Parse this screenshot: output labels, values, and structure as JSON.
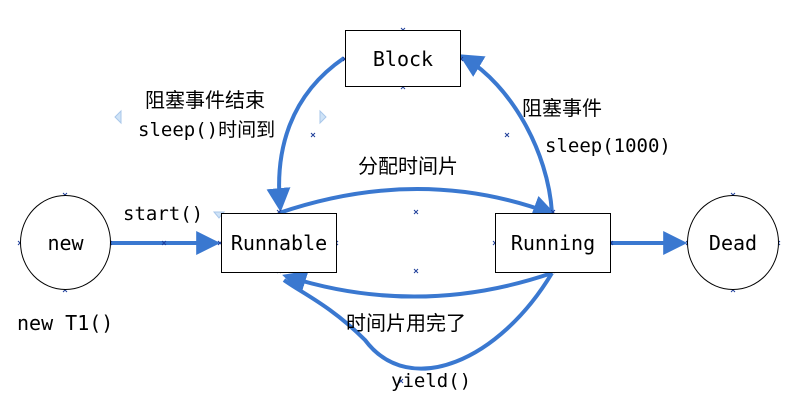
{
  "nodes": {
    "new": "new",
    "runnable": "Runnable",
    "running": "Running",
    "block": "Block",
    "dead": "Dead"
  },
  "labels": {
    "new_object": "new T1()",
    "start": "start()",
    "time_slice_assigned": "分配时间片",
    "time_slice_used_up": "时间片用完了",
    "yield": "yield()",
    "block_event": "阻塞事件",
    "sleep_call": "sleep(1000)",
    "block_event_end": "阻塞事件结束",
    "sleep_timeout": "sleep()时间到"
  },
  "colors": {
    "arrow": "#3a78d0",
    "handle": "#1f3f9a",
    "border": "#000000"
  }
}
